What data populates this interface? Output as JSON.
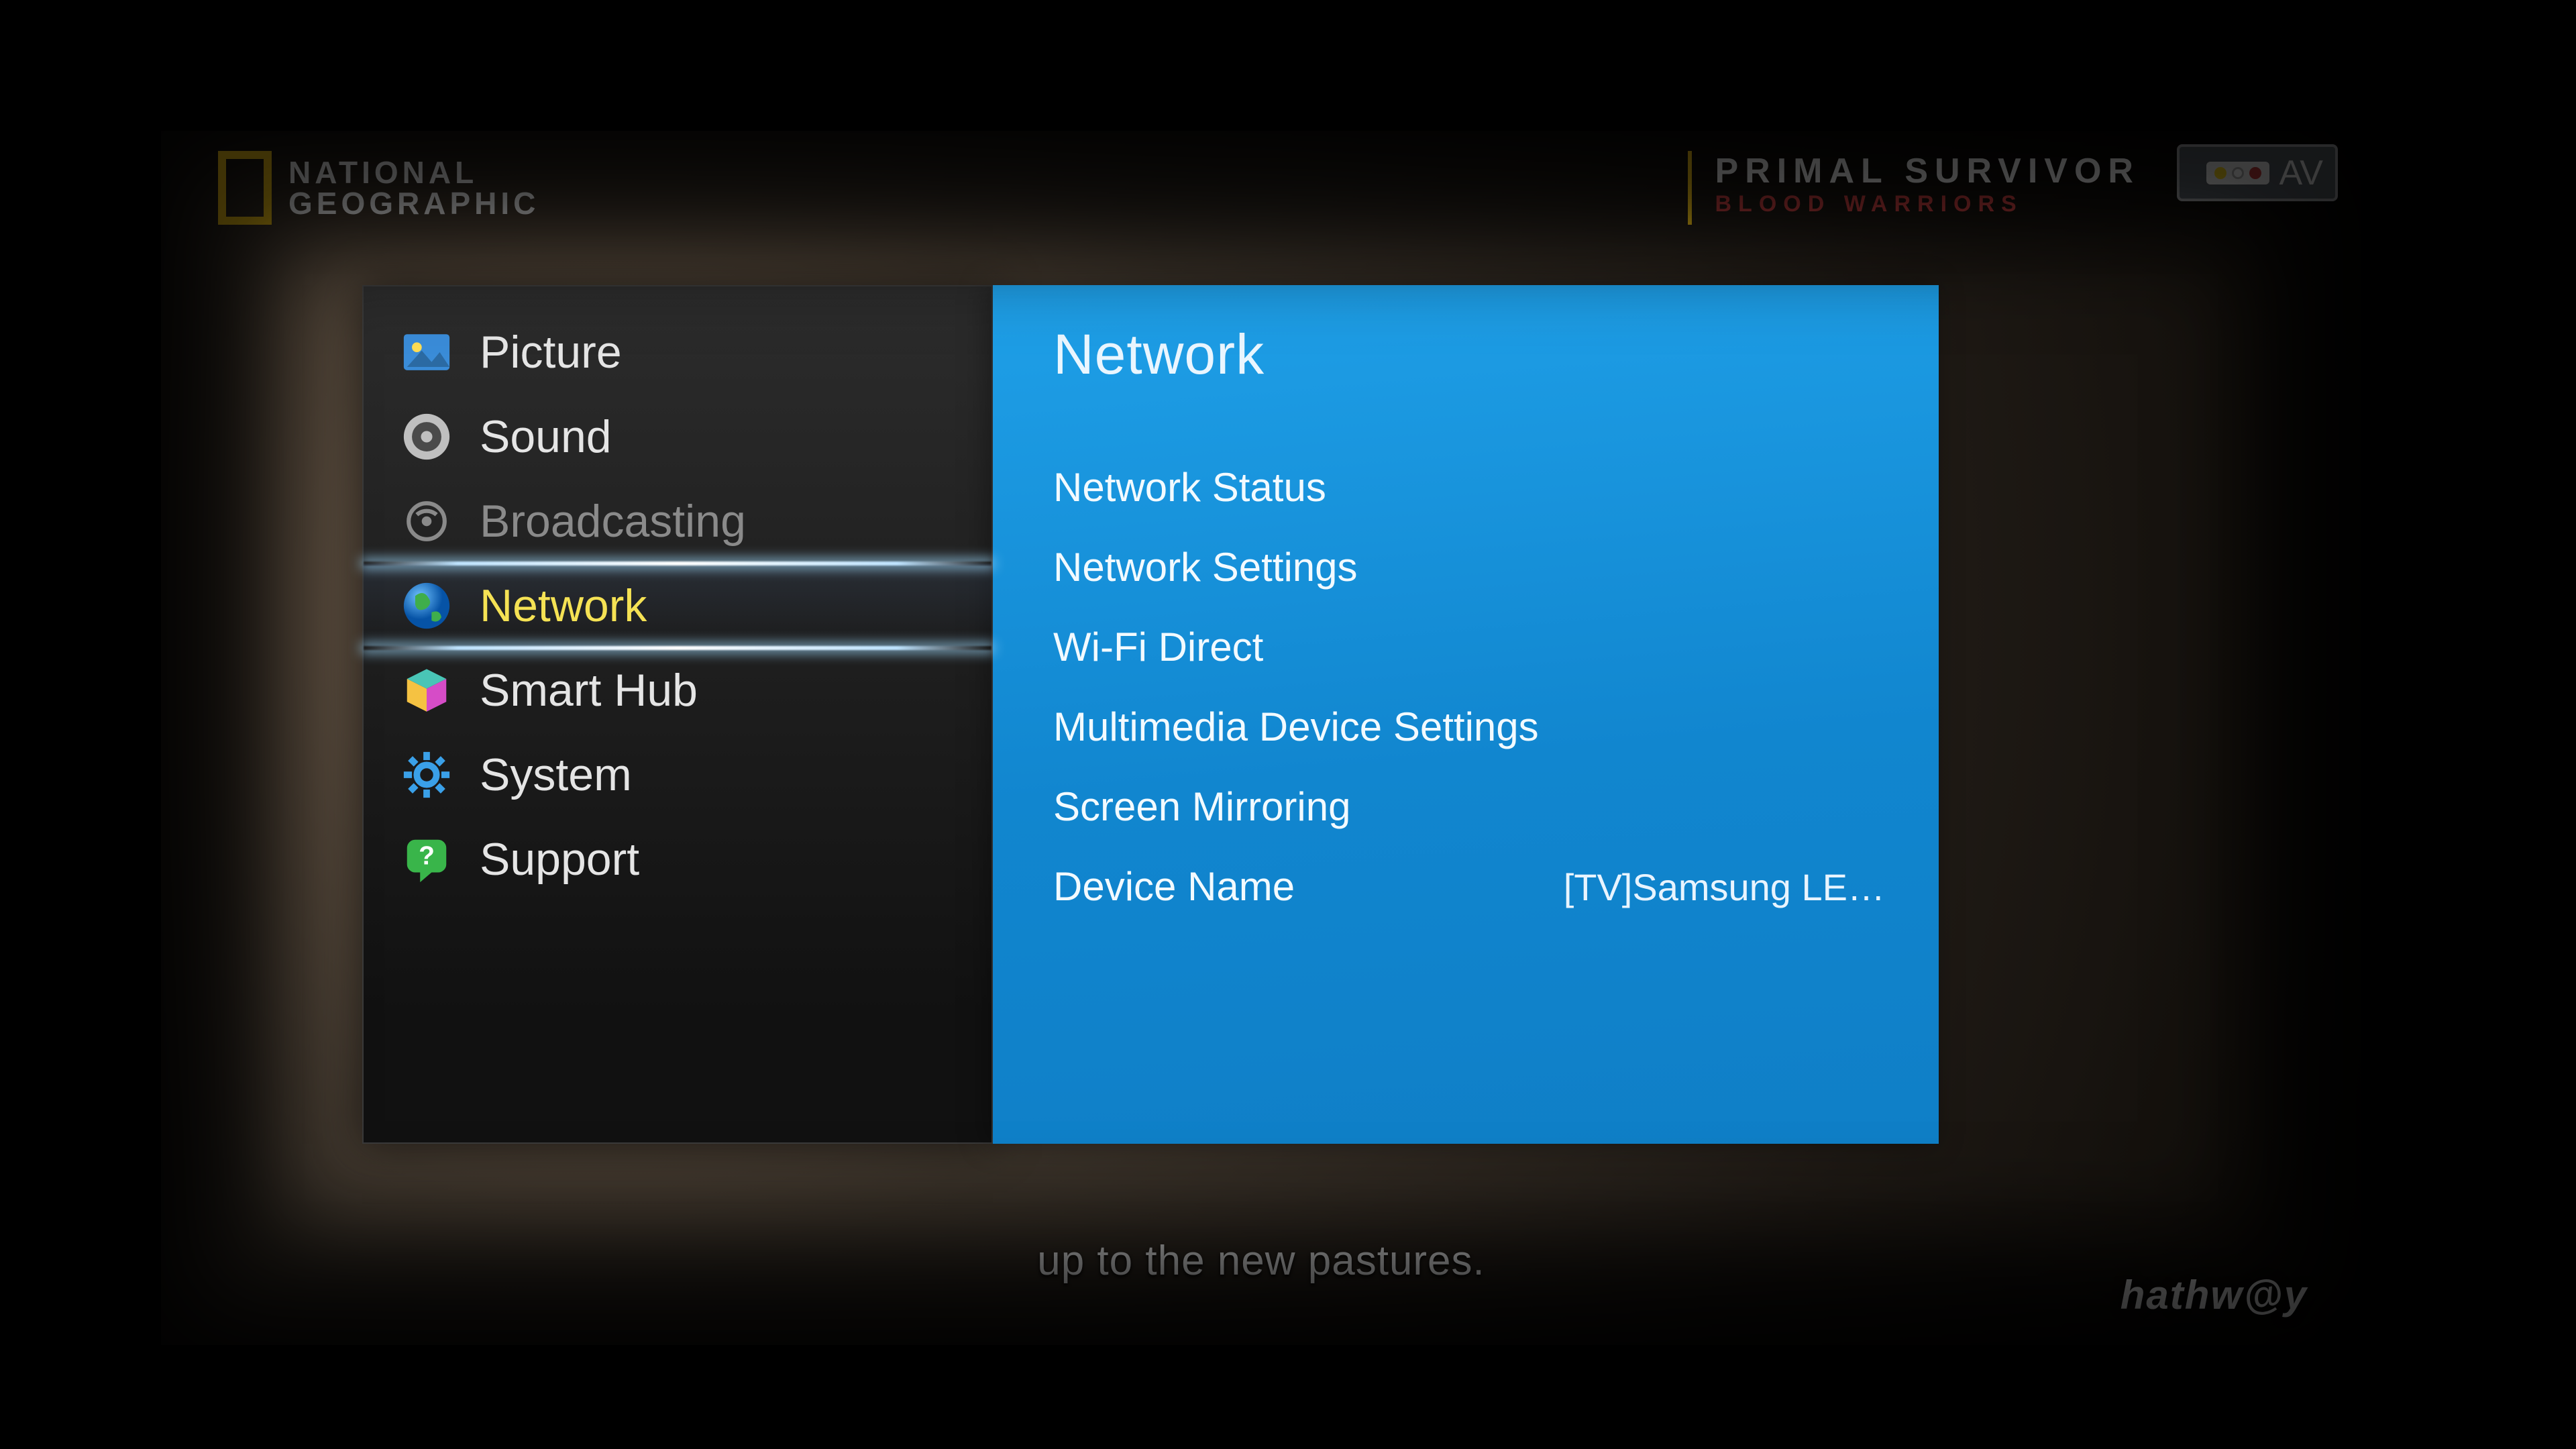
{
  "channel": {
    "logo_line1": "NATIONAL",
    "logo_line2": "GEOGRAPHIC"
  },
  "program": {
    "title": "PRIMAL SURVIVOR",
    "subtitle": "BLOOD WARRIORS"
  },
  "input_badge": {
    "label": "AV"
  },
  "subtitle_text": "up to the new pastures.",
  "provider": "hathw@y",
  "settings": {
    "side_menu": [
      {
        "id": "picture",
        "label": "Picture",
        "icon": "picture-icon",
        "state": "normal"
      },
      {
        "id": "sound",
        "label": "Sound",
        "icon": "sound-icon",
        "state": "normal"
      },
      {
        "id": "broadcasting",
        "label": "Broadcasting",
        "icon": "broadcast-icon",
        "state": "disabled"
      },
      {
        "id": "network",
        "label": "Network",
        "icon": "globe-icon",
        "state": "selected"
      },
      {
        "id": "smart-hub",
        "label": "Smart Hub",
        "icon": "cube-icon",
        "state": "normal"
      },
      {
        "id": "system",
        "label": "System",
        "icon": "gear-icon",
        "state": "normal"
      },
      {
        "id": "support",
        "label": "Support",
        "icon": "support-icon",
        "state": "normal"
      }
    ],
    "panel": {
      "title": "Network",
      "items": [
        {
          "label": "Network Status",
          "value": ""
        },
        {
          "label": "Network Settings",
          "value": ""
        },
        {
          "label": "Wi-Fi Direct",
          "value": ""
        },
        {
          "label": "Multimedia Device Settings",
          "value": ""
        },
        {
          "label": "Screen Mirroring",
          "value": ""
        },
        {
          "label": "Device Name",
          "value": "[TV]Samsung LE…"
        }
      ]
    }
  }
}
